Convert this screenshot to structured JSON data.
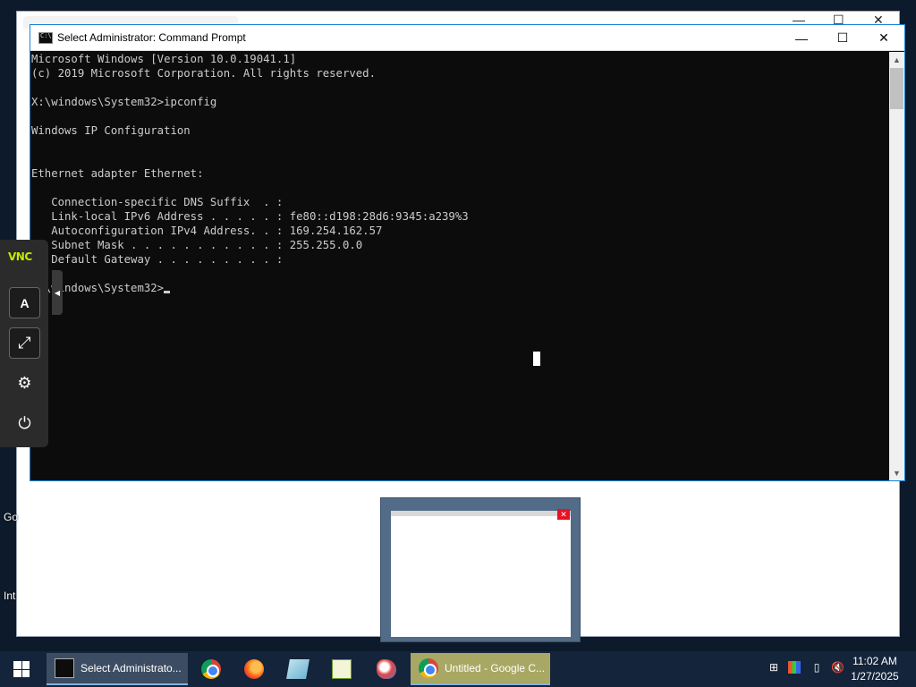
{
  "desktop": {
    "left_labels": [
      "Go",
      "Int"
    ]
  },
  "cmd_window": {
    "title": "Select Administrator: Command Prompt",
    "controls": {
      "minimize": "—",
      "maximize": "☐",
      "close": "✕"
    },
    "lines": [
      "Microsoft Windows [Version 10.0.19041.1]",
      "(c) 2019 Microsoft Corporation. All rights reserved.",
      "",
      "X:\\windows\\System32>ipconfig",
      "",
      "Windows IP Configuration",
      "",
      "",
      "Ethernet adapter Ethernet:",
      "",
      "   Connection-specific DNS Suffix  . :",
      "   Link-local IPv6 Address . . . . . : fe80::d198:28d6:9345:a239%3",
      "   Autoconfiguration IPv4 Address. . : 169.254.162.57",
      "   Subnet Mask . . . . . . . . . . . : 255.255.0.0",
      "   Default Gateway . . . . . . . . . :",
      "",
      "X:\\windows\\System32>"
    ]
  },
  "vnc_toolbar": {
    "logo": "VNC",
    "buttons": [
      {
        "name": "keyboard-a-icon",
        "glyph": "A"
      },
      {
        "name": "scale-icon",
        "glyph": "⤢"
      },
      {
        "name": "settings-icon",
        "glyph": "⚙"
      },
      {
        "name": "power-icon",
        "glyph": "⏻"
      }
    ],
    "handle": "◀"
  },
  "taskbar": {
    "cmd_item": "Select Administrato...",
    "chrome_item": "Untitled - Google C...",
    "clock_time": "11:02 AM",
    "clock_date": "1/27/2025"
  },
  "thumbnail": {
    "close": "✕"
  }
}
